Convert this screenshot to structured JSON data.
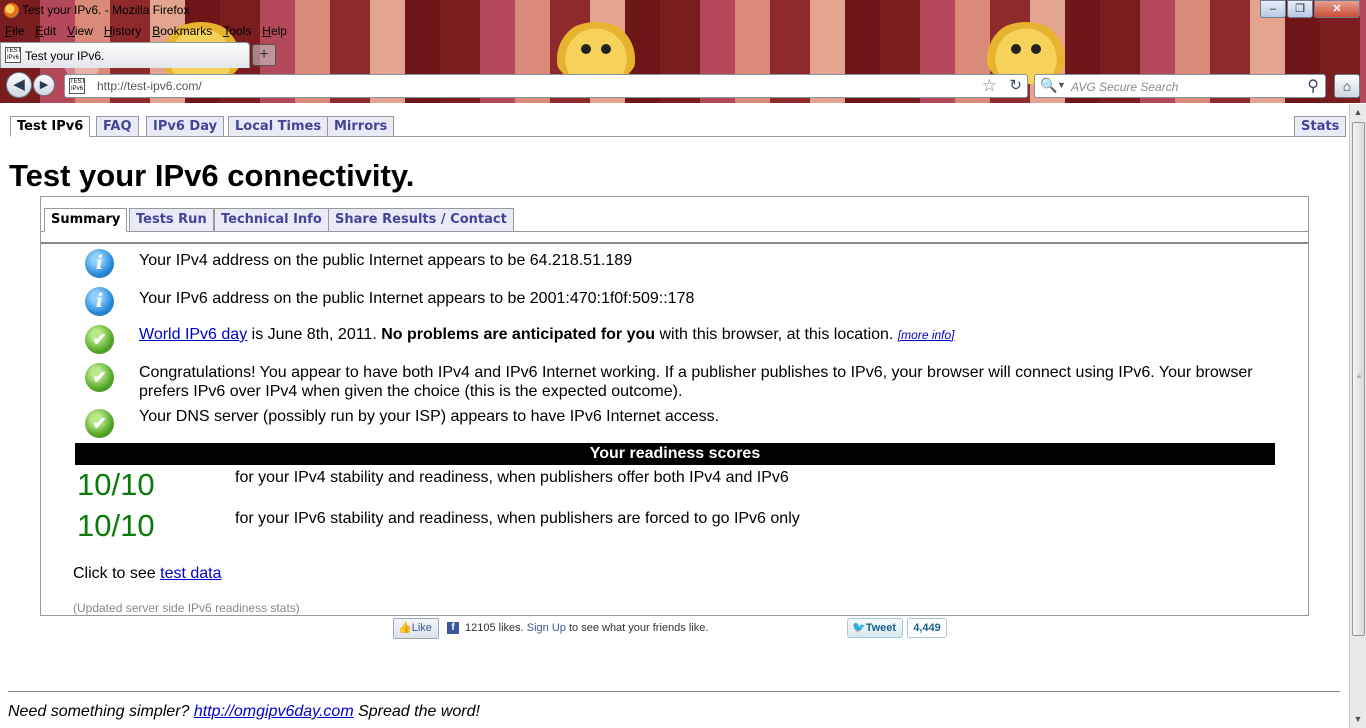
{
  "window": {
    "title": "Test your IPv6. - Mozilla Firefox",
    "minimize_glyph": "–",
    "maximize_glyph": "❐",
    "close_glyph": "✕"
  },
  "menu": [
    "File",
    "Edit",
    "View",
    "History",
    "Bookmarks",
    "Tools",
    "Help"
  ],
  "browser_tab": {
    "favicon_text": "TEST IPv6",
    "label": "Test your IPv6.",
    "new_tab_glyph": "+"
  },
  "navbar": {
    "url": "http://test-ipv6.com/",
    "favicon_text": "TEST IPv6",
    "search_placeholder": "AVG Secure Search"
  },
  "site_tabs": {
    "left": [
      "Test IPv6",
      "FAQ",
      "IPv6 Day",
      "Local Times",
      "Mirrors"
    ],
    "right": "Stats",
    "active": "Test IPv6"
  },
  "page_title": "Test your IPv6 connectivity.",
  "inner_tabs": [
    "Summary",
    "Tests Run",
    "Technical Info",
    "Share Results / Contact"
  ],
  "results": {
    "ipv4": "Your IPv4 address on the public Internet appears to be 64.218.51.189",
    "ipv6": "Your IPv6 address on the public Internet appears to be 2001:470:1f0f:509::178",
    "worldday_link": "World IPv6 day",
    "worldday_text": " is June 8th, 2011. ",
    "worldday_bold": "No problems are anticipated for you",
    "worldday_rest": " with this browser, at this location. ",
    "more_info": "[more info]",
    "congrats": "Congratulations! You appear to have both IPv4 and IPv6 Internet working. If a publisher publishes to IPv6, your browser will connect using IPv6. Your browser prefers IPv6 over IPv4 when given the choice (this is the expected outcome).",
    "dns": "Your DNS server (possibly run by your ISP) appears to have IPv6 Internet access."
  },
  "status_icons": [
    "info",
    "info",
    "ok",
    "ok",
    "ok"
  ],
  "scores": {
    "header": "Your readiness scores",
    "ipv4_score": "10/10",
    "ipv4_desc": "for your IPv4 stability and readiness, when publishers offer both IPv4 and IPv6",
    "ipv6_score": "10/10",
    "ipv6_desc": "for your IPv6 stability and readiness, when publishers are forced to go IPv6 only",
    "score_color": "#0a7a0a"
  },
  "test_data": {
    "prefix": "Click to see ",
    "link": "test data"
  },
  "updated_note": "(Updated server side IPv6 readiness stats)",
  "social": {
    "like_label": "Like",
    "likes_count": "12105 likes.",
    "signup": "Sign Up",
    "signup_rest": " to see what your friends like.",
    "tweet_label": "Tweet",
    "tweet_count": "4,449"
  },
  "footer": {
    "prefix": "Need something simpler? ",
    "link": "http://omgipv6day.com",
    "suffix": " Spread the word!"
  }
}
